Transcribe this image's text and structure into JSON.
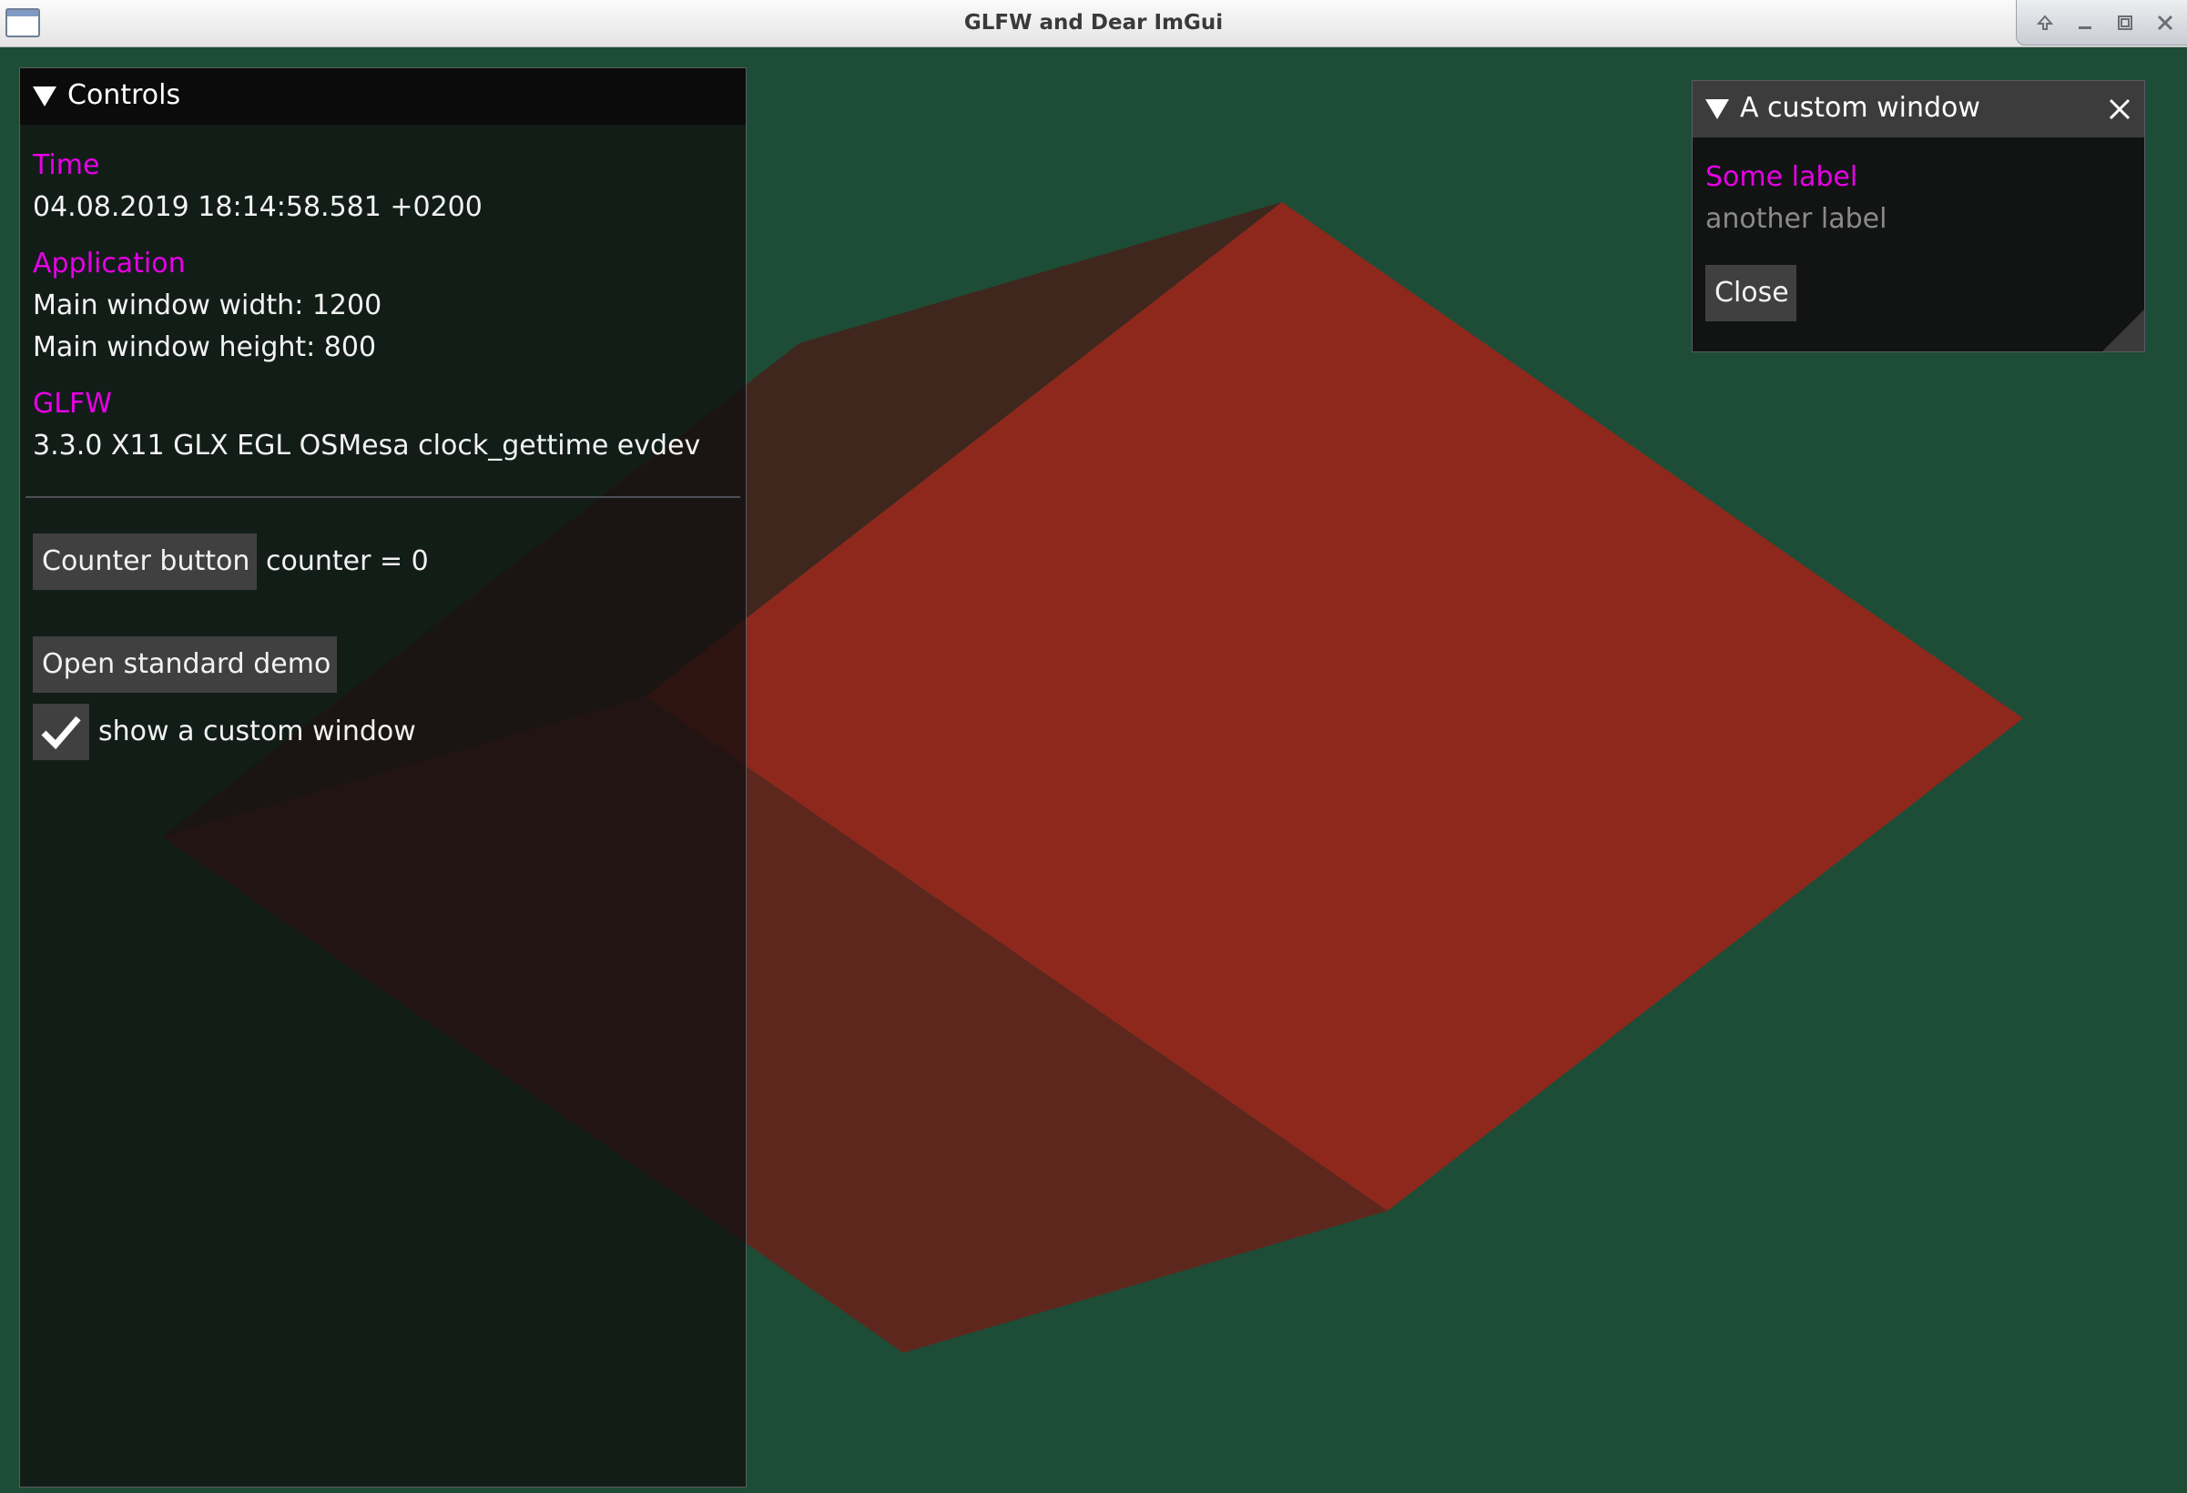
{
  "window": {
    "title": "GLFW and Dear ImGui",
    "controls": [
      "shade-button",
      "minimize-button",
      "maximize-button",
      "close-button"
    ]
  },
  "controls_window": {
    "title": "Controls",
    "sections": [
      {
        "heading": "Time",
        "lines": [
          "04.08.2019 18:14:58.581 +0200"
        ]
      },
      {
        "heading": "Application",
        "lines": [
          "Main window width: 1200",
          "Main window height: 800"
        ]
      },
      {
        "heading": "GLFW",
        "lines": [
          "3.3.0 X11 GLX EGL OSMesa clock_gettime evdev"
        ]
      }
    ],
    "counter_button_label": "Counter button",
    "counter_text": "counter = 0",
    "open_demo_label": "Open standard demo",
    "checkbox": {
      "label": "show a custom window",
      "checked": true
    }
  },
  "custom_window": {
    "title": "A custom window",
    "label_primary": "Some label",
    "label_secondary": "another label",
    "close_button_label": "Close"
  },
  "colors": {
    "background": "#1d4d36",
    "shape_front": "#8e281c",
    "shape_back": "#3f271e",
    "heading_magenta": "#e600e6",
    "button": "#404040"
  }
}
